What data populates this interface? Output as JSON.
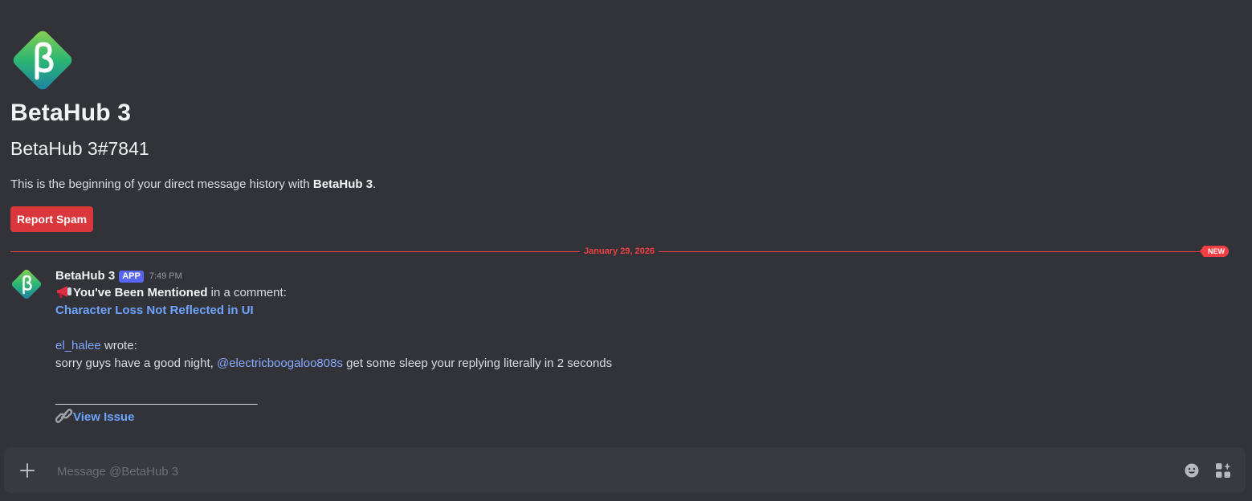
{
  "profile": {
    "name": "BetaHub 3",
    "tag": "BetaHub 3#7841",
    "intro_prefix": "This is the beginning of your direct message history with ",
    "intro_name": "BetaHub 3",
    "intro_suffix": ".",
    "report_label": "Report Spam",
    "logo_letter": "β"
  },
  "divider": {
    "date": "January 29, 2026",
    "new_label": "NEW"
  },
  "message": {
    "author": "BetaHub 3",
    "badge": "APP",
    "time": "7:49 PM",
    "mentioned_bold": "You've Been Mentioned",
    "mentioned_rest": " in a comment:",
    "issue_title": "Character Loss Not Reflected in UI",
    "commenter": "el_halee",
    "wrote": " wrote:",
    "body_prefix": "sorry guys have a good night, ",
    "body_mention": "@electricboogaloo808s",
    "body_suffix": " get some sleep your replying literally in 2 seconds",
    "separator": "________________________________",
    "view_issue": "View Issue"
  },
  "composer": {
    "placeholder": "Message @BetaHub 3"
  },
  "icons": {
    "megaphone": "megaphone-icon",
    "link": "link-icon",
    "plus": "plus-icon",
    "emoji": "emoji-icon",
    "apps": "apps-icon"
  },
  "colors": {
    "background": "#313338",
    "accent_red": "#da373c",
    "new_red": "#f23f43",
    "badge_blurple": "#5865f2",
    "link_blue": "#6ea3ff"
  }
}
